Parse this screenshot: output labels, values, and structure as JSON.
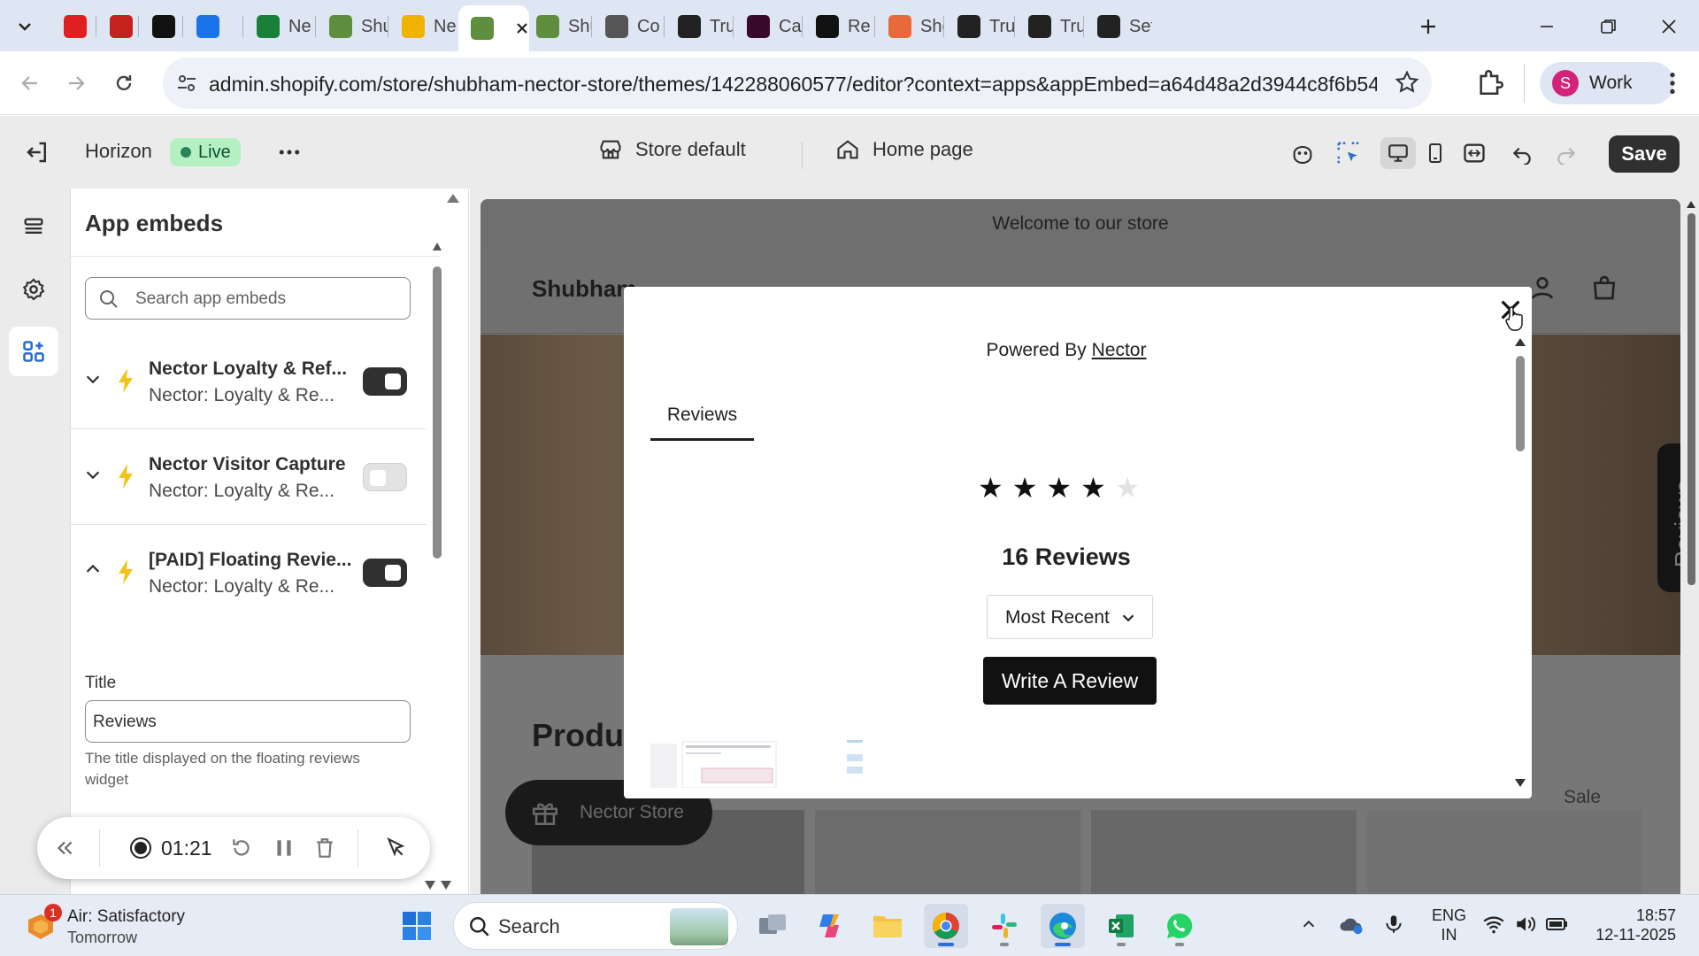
{
  "browser": {
    "tabs": [
      {
        "title": "",
        "fav": "youtube",
        "color": "#e02020"
      },
      {
        "title": "",
        "fav": "gmail",
        "color": "#c5221f"
      },
      {
        "title": "",
        "fav": "chatgpt",
        "color": "#111111"
      },
      {
        "title": "",
        "fav": "calendar",
        "color": "#1a73e8"
      },
      {
        "title": "Ne",
        "fav": "sheets",
        "color": "#188038"
      },
      {
        "title": "Shu",
        "fav": "shopify",
        "color": "#5e8e3e"
      },
      {
        "title": "Ne",
        "fav": "nector",
        "color": "#f0b400"
      },
      {
        "title": "",
        "fav": "shopify",
        "color": "#5e8e3e",
        "active": true
      },
      {
        "title": "Shu",
        "fav": "shopify",
        "color": "#5e8e3e"
      },
      {
        "title": "Co",
        "fav": "globe",
        "color": "#555555"
      },
      {
        "title": "Tru",
        "fav": "box",
        "color": "#222222"
      },
      {
        "title": "Caf",
        "fav": "cafe",
        "color": "#3a0a2a"
      },
      {
        "title": "Re",
        "fav": "diamond",
        "color": "#111111"
      },
      {
        "title": "She",
        "fav": "drop",
        "color": "#e86a3a"
      },
      {
        "title": "Tru",
        "fav": "box",
        "color": "#222222"
      },
      {
        "title": "Tru",
        "fav": "box",
        "color": "#222222"
      },
      {
        "title": "Set",
        "fav": "box",
        "color": "#222222"
      }
    ],
    "url_host": "admin.shopify.com",
    "url_path": "/store/shubham-nector-store/themes/142288060577/editor?context=apps&appEmbed=a64d48a2d3944c8f6b543bef62d1c...",
    "profile_label": "Work",
    "profile_initial": "S"
  },
  "editor": {
    "theme_name": "Horizon",
    "status_badge": "Live",
    "template_label": "Store default",
    "page_label": "Home page",
    "save_label": "Save"
  },
  "panel": {
    "title": "App embeds",
    "search_placeholder": "Search app embeds",
    "embeds": [
      {
        "name": "Nector Loyalty & Ref...",
        "provider": "Nector: Loyalty & Re...",
        "enabled": true,
        "expanded": false
      },
      {
        "name": "Nector Visitor Capture",
        "provider": "Nector: Loyalty & Re...",
        "enabled": false,
        "expanded": false
      },
      {
        "name": "[PAID] Floating Revie...",
        "provider": "Nector: Loyalty & Re...",
        "enabled": true,
        "expanded": true
      }
    ],
    "field_label": "Title",
    "field_value": "Reviews",
    "field_help": "The title displayed on the floating reviews widget"
  },
  "recorder": {
    "elapsed": "01:21"
  },
  "store": {
    "announcement": "Welcome to our store",
    "brand": "Shubham",
    "section_heading": "Produ",
    "floating_tab_label": "Reviews",
    "nector_button_label": "Nector Store",
    "sale_badge": "Sale"
  },
  "modal": {
    "powered_prefix": "Powered By",
    "powered_link": "Nector",
    "tab_label": "Reviews",
    "rating": 4,
    "max_rating": 5,
    "review_count_label": "16 Reviews",
    "sort_value": "Most Recent",
    "write_review_label": "Write A Review"
  },
  "taskbar": {
    "weather_title": "Air: Satisfactory",
    "weather_sub": "Tomorrow",
    "weather_badge": "1",
    "search_label": "Search",
    "lang_line1": "ENG",
    "lang_line2": "IN",
    "time": "18:57",
    "date": "12-11-2025"
  }
}
